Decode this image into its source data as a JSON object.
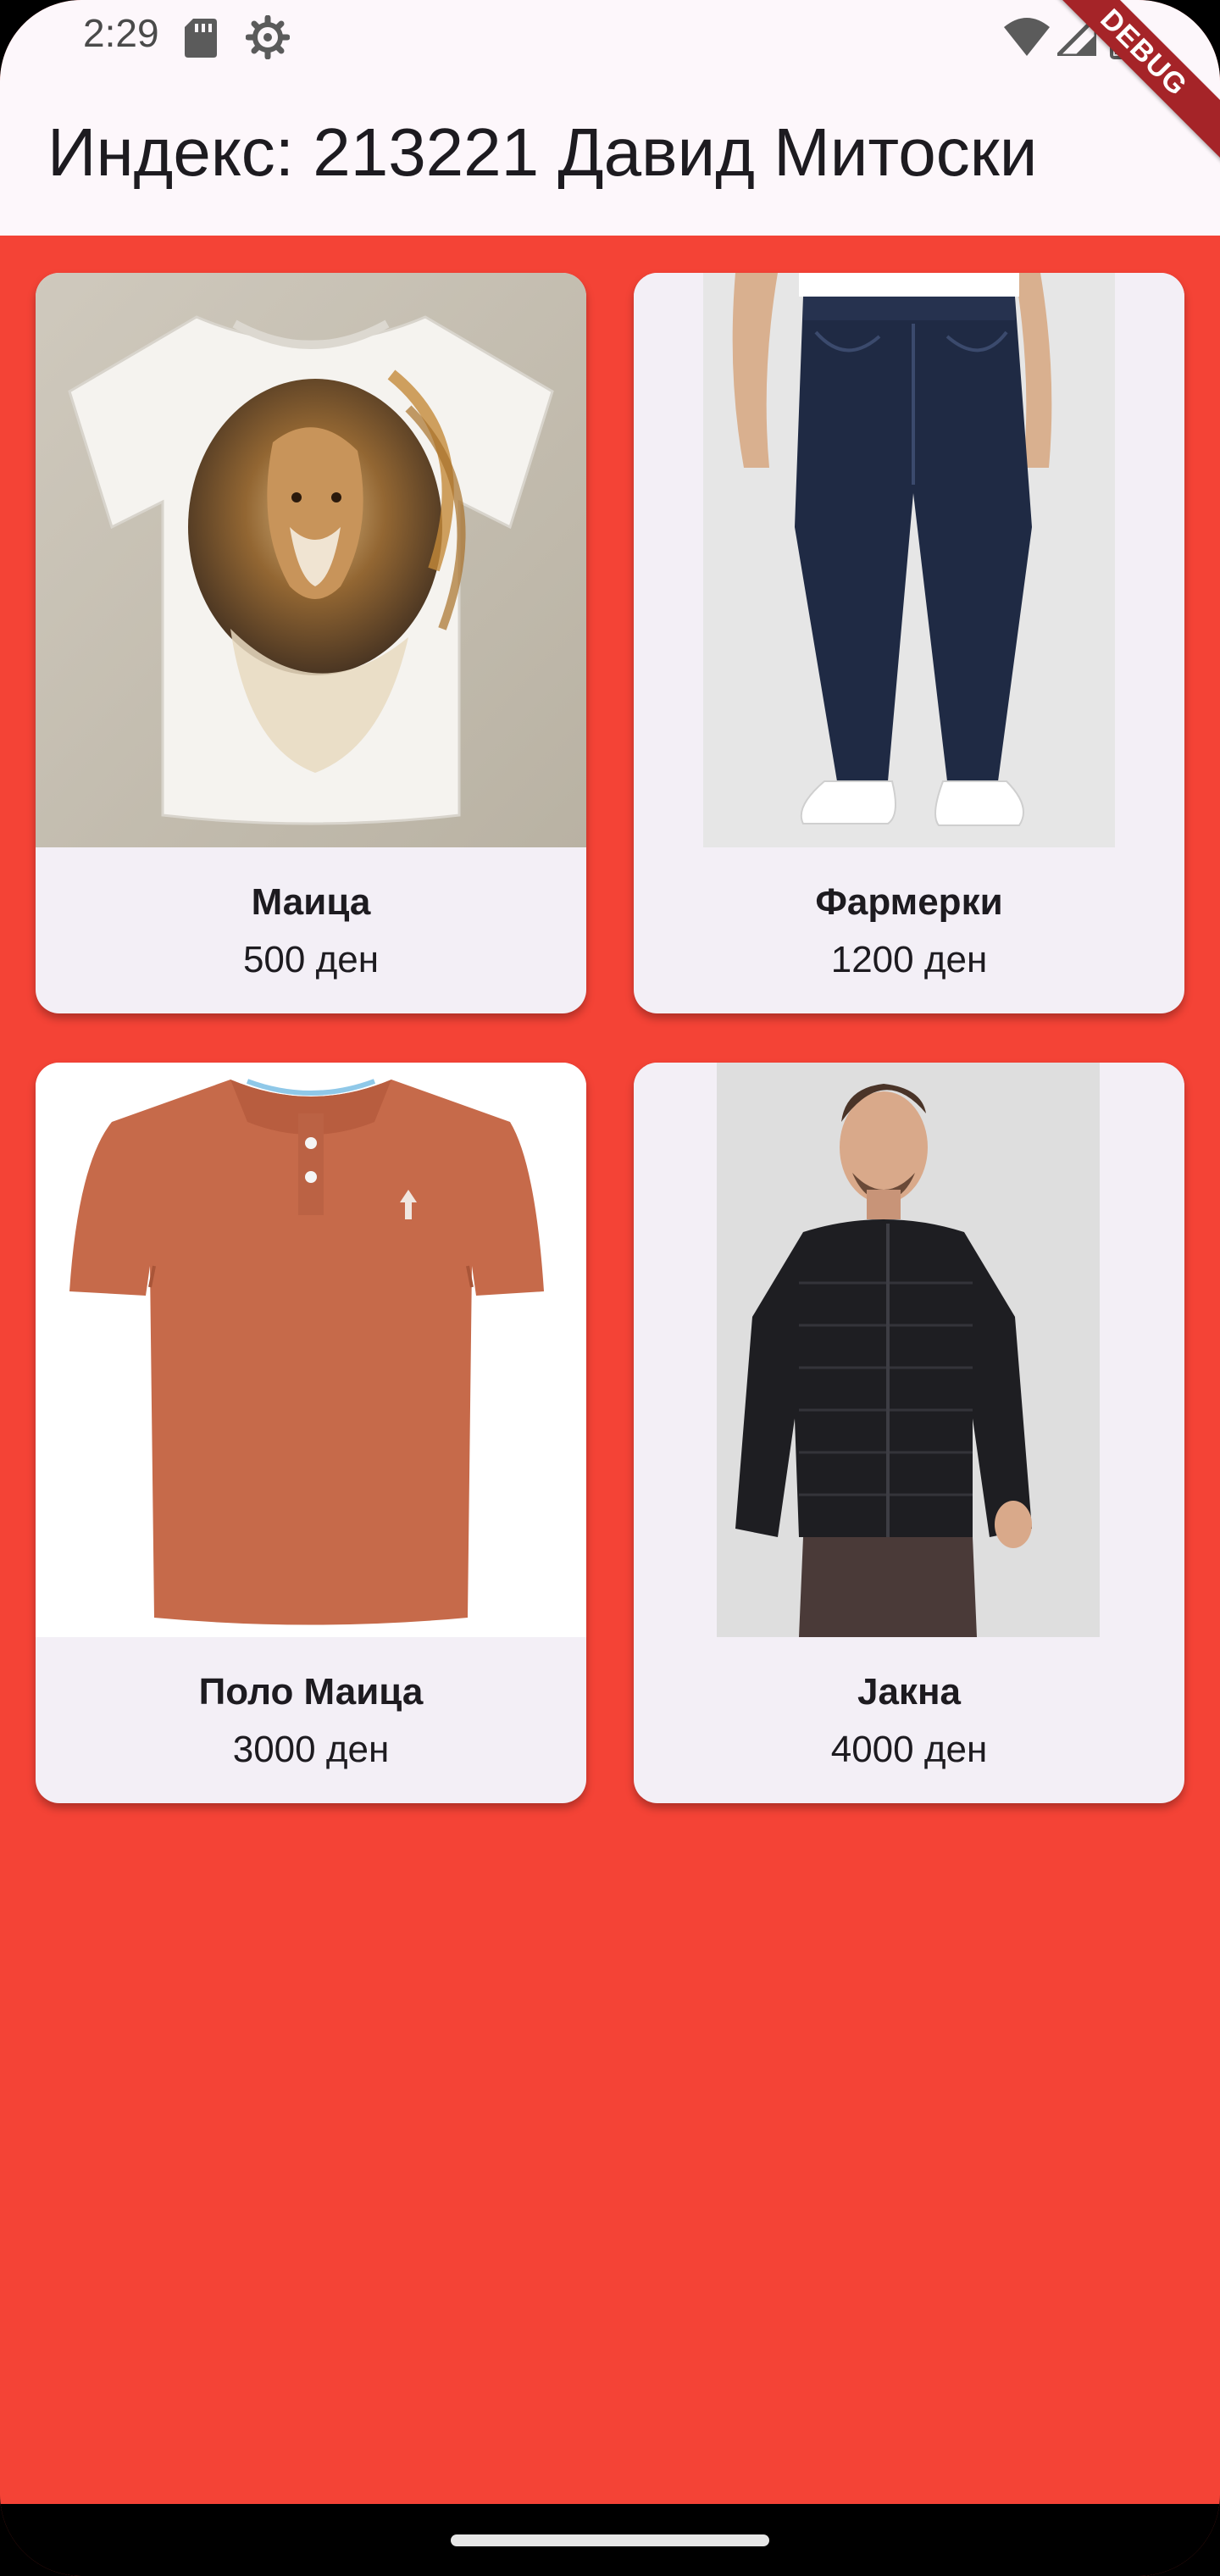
{
  "status_bar": {
    "time": "2:29",
    "icons": [
      "sd-card-icon",
      "gear-icon",
      "wifi-icon",
      "signal-icon",
      "battery-icon"
    ]
  },
  "app_bar": {
    "title": "Индекс: 213221 Давид Митоски"
  },
  "debug_banner": "DEBUG",
  "products": [
    {
      "name": "Маица",
      "price": "500 ден",
      "image": "white-lion-tshirt-image"
    },
    {
      "name": "Фармерки",
      "price": "1200 ден",
      "image": "jeans-image"
    },
    {
      "name": "Поло Маица",
      "price": "3000 ден",
      "image": "orange-polo-shirt-image"
    },
    {
      "name": "Јакна",
      "price": "4000 ден",
      "image": "black-jacket-image"
    }
  ],
  "colors": {
    "background": "#f44336",
    "app_bar": "#fdf7fb",
    "card": "#f3eff6",
    "debug": "#a52428"
  }
}
